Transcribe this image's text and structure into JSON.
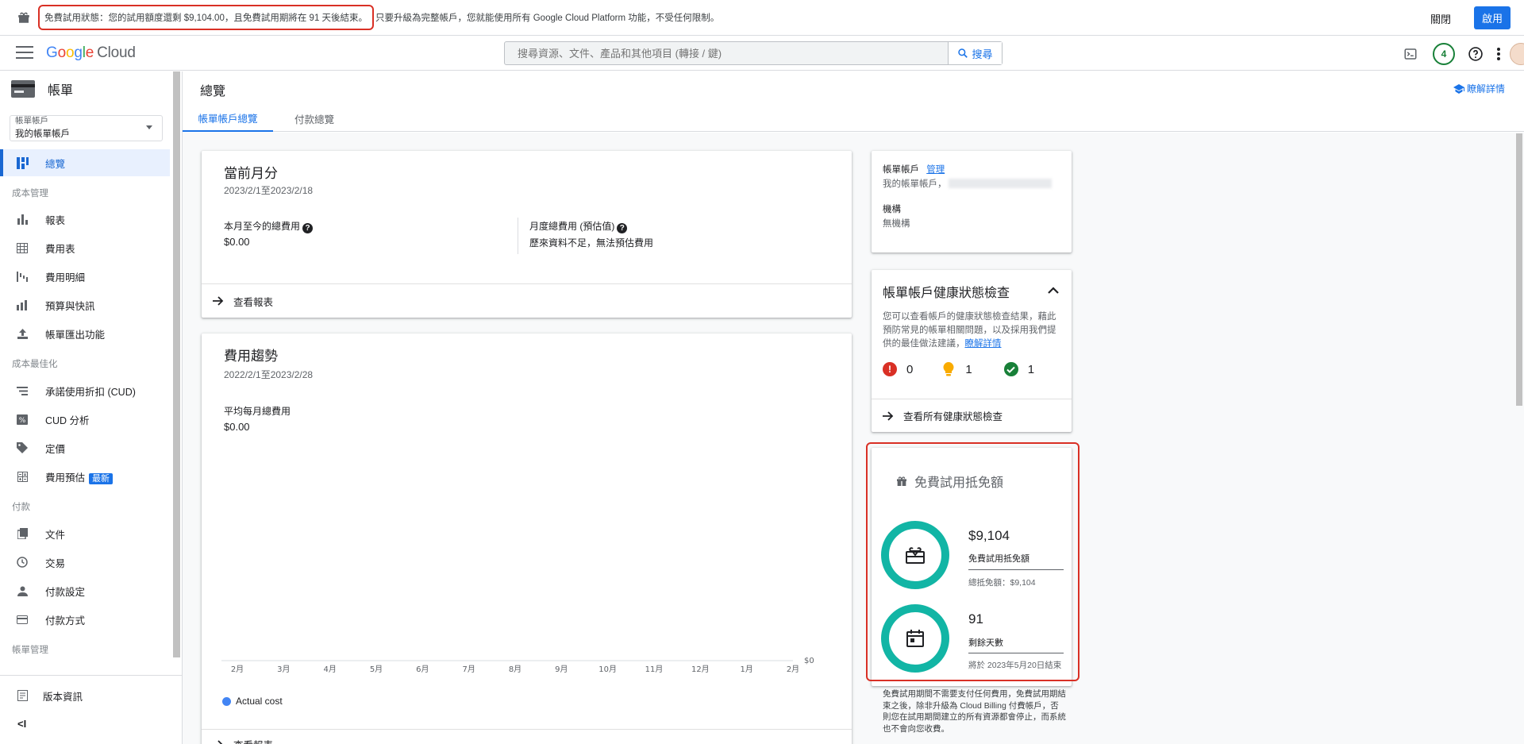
{
  "banner": {
    "highlight_text": "免費試用狀態：您的試用額度還剩 $9,104.00，且免費試用期將在 91 天後結束。",
    "rest_text": "只要升級為完整帳戶，您就能使用所有 Google Cloud Platform 功能，不受任何限制。",
    "close_label": "關閉",
    "activate_label": "啟用"
  },
  "header": {
    "logo_google": [
      "G",
      "o",
      "o",
      "g",
      "l",
      "e"
    ],
    "logo_cloud": "Cloud",
    "search_placeholder": "搜尋資源、文件、產品和其他項目 (轉接 / 鍵)",
    "search_button": "搜尋",
    "notification_count": "4"
  },
  "sidebar": {
    "title": "帳單",
    "account_label": "帳單帳戶",
    "account_value": "我的帳單帳戶",
    "items": {
      "overview": "總覽",
      "sec_cost_mgmt": "成本管理",
      "reports": "報表",
      "cost_table": "費用表",
      "cost_breakdown": "費用明細",
      "budgets": "預算與快訊",
      "billing_export": "帳單匯出功能",
      "sec_cost_opt": "成本最佳化",
      "cud": "承諾使用折扣 (CUD)",
      "cud_analysis": "CUD 分析",
      "pricing": "定價",
      "cost_estimate": "費用預估",
      "new_badge": "最新",
      "sec_payment": "付款",
      "documents": "文件",
      "transactions": "交易",
      "payment_settings": "付款設定",
      "payment_method": "付款方式",
      "sec_account_mgmt": "帳單管理",
      "release_notes": "版本資訊"
    }
  },
  "page": {
    "title": "總覽",
    "learn_more": "瞭解詳情",
    "tabs": [
      "帳單帳戶總覽",
      "付款總覽"
    ]
  },
  "current_month": {
    "title": "當前月分",
    "date_range": "2023/2/1至2023/2/18",
    "mtd_label": "本月至今的總費用",
    "mtd_value": "$0.00",
    "forecast_label": "月度總費用 (預估值)",
    "forecast_value": "歷來資料不足，無法預估費用",
    "link": "查看報表"
  },
  "trend": {
    "title": "費用趨勢",
    "date_range": "2022/2/1至2023/2/28",
    "avg_label": "平均每月總費用",
    "avg_value": "$0.00",
    "legend": "Actual cost",
    "link_partial": "查看報表"
  },
  "chart_data": {
    "type": "line",
    "categories": [
      "2月",
      "3月",
      "4月",
      "5月",
      "6月",
      "7月",
      "8月",
      "9月",
      "10月",
      "11月",
      "12月",
      "1月",
      "2月"
    ],
    "series": [
      {
        "name": "Actual cost",
        "values": [
          0,
          0,
          0,
          0,
          0,
          0,
          0,
          0,
          0,
          0,
          0,
          0,
          0
        ]
      }
    ],
    "y_tick": "$0",
    "color": "#4285f4"
  },
  "account_card": {
    "acct_label": "帳單帳戶",
    "manage_link": "管理",
    "acct_value": "我的帳單帳戶，",
    "org_label": "機構",
    "org_value": "無機構"
  },
  "health": {
    "title": "帳單帳戶健康狀態檢查",
    "desc": "您可以查看帳戶的健康狀態檢查結果，藉此預防常見的帳單相關問題，以及採用我們提供的最佳做法建議，",
    "desc_link": "瞭解詳情",
    "error_count": "0",
    "warning_count": "1",
    "ok_count": "1",
    "link": "查看所有健康狀態檢查"
  },
  "credits": {
    "title": "免費試用抵免額",
    "amount": "$9,104",
    "amount_label": "免費試用抵免額",
    "total_label": "總抵免額：$9,104",
    "days": "91",
    "days_label": "剩餘天數",
    "end_label": "將於 2023年5月20日結束",
    "footer": "免費試用期間不需要支付任何費用，免費試用期結束之後，除非升級為 Cloud Billing 付費帳戶，否則您在試用期間建立的所有資源都會停止，而系統也不會向您收費。"
  },
  "colors": {
    "accent": "#1a73e8",
    "ring": "#12b5a5",
    "error": "#d93025",
    "warning": "#f9ab00",
    "ok": "#188038"
  }
}
